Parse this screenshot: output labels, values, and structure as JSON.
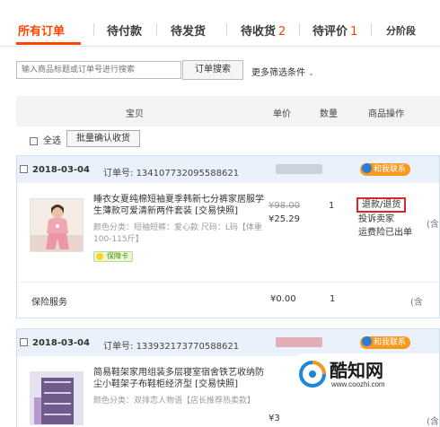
{
  "tabs": [
    {
      "label": "所有订单",
      "count": ""
    },
    {
      "label": "待付款",
      "count": ""
    },
    {
      "label": "待发货",
      "count": ""
    },
    {
      "label": "待收货",
      "count": "2"
    },
    {
      "label": "待评价",
      "count": "1"
    },
    {
      "label": "分阶段",
      "count": ""
    }
  ],
  "search": {
    "placeholder": "输入商品标题或订单号进行搜索",
    "button_label": "订单搜索",
    "more_filters": "更多筛选条件"
  },
  "columns": [
    "宝贝",
    "单价",
    "数量",
    "商品操作"
  ],
  "select_all_label": "全选",
  "batch_confirm_label": "批量确认收货",
  "orders": [
    {
      "date": "2018-03-04",
      "order_no_label": "订单号:",
      "order_no": "134107732095588621",
      "contact_label": "和我联系",
      "item": {
        "title": "睡衣女夏纯棉短袖夏季韩新七分裤家居服学生薄款可爱清新两件套装 [交易快照]",
        "attrs": "颜色分类：短袖短裤：爱心款  尺码：L码【体重100-115斤】",
        "badge": "保障卡",
        "price_old": "¥98.00",
        "price_new": "¥25.29",
        "qty": "1",
        "ops": [
          "退款/退货",
          "投诉卖家",
          "运费险已出单"
        ],
        "cut_text": "(含"
      },
      "service": {
        "label": "保险服务",
        "price": "¥0.00",
        "qty": "1",
        "cut_text": "(含"
      }
    },
    {
      "date": "2018-03-04",
      "order_no_label": "订单号:",
      "order_no": "133932173770588621",
      "contact_label": "和我联系",
      "item": {
        "title": "简易鞋架家用组装多层寝室宿舍铁艺收纳防尘小鞋架子布鞋柜经济型 [交易快照]",
        "attrs": "颜色分类：双排恋人物语【店长推荐热卖款】",
        "price_new": "¥3",
        "cut_text": "(含"
      }
    }
  ],
  "watermark": {
    "name": "酷知网",
    "url": "www.coozhi.com"
  }
}
